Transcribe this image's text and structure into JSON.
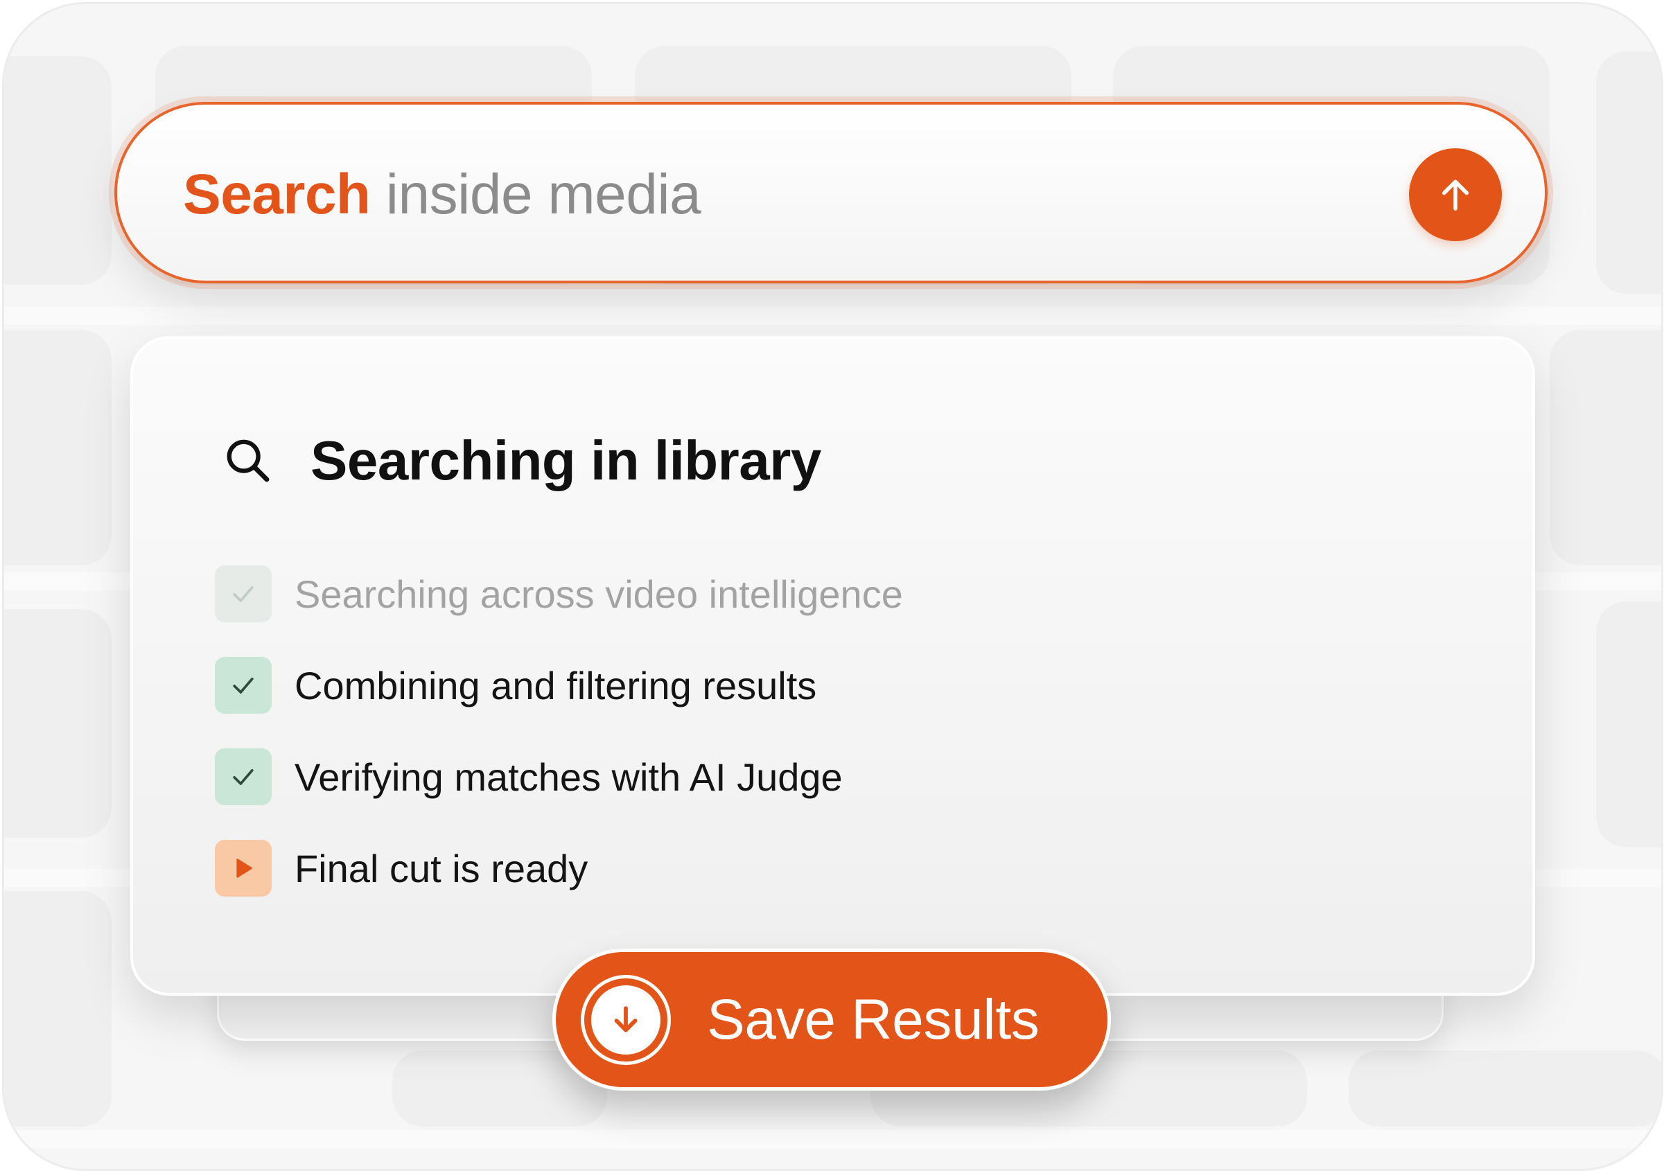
{
  "search_bar": {
    "accent_text": "Search",
    "rest_text": " inside media",
    "send_icon": "arrow-up-icon"
  },
  "status_card": {
    "title_icon": "search-icon",
    "title": "Searching in library",
    "steps": [
      {
        "label": "Searching across video intelligence",
        "state": "faded",
        "icon": "check-icon"
      },
      {
        "label": "Combining and filtering results",
        "state": "done",
        "icon": "check-icon"
      },
      {
        "label": "Verifying matches with AI Judge",
        "state": "done",
        "icon": "check-icon"
      },
      {
        "label": "Final cut is ready",
        "state": "active",
        "icon": "play-icon"
      }
    ]
  },
  "save_button": {
    "label": "Save Results",
    "icon": "download-arrow-icon"
  },
  "colors": {
    "accent": "#e25417",
    "done_box": "#c9e6d6",
    "active_box": "#f9c9a6"
  }
}
